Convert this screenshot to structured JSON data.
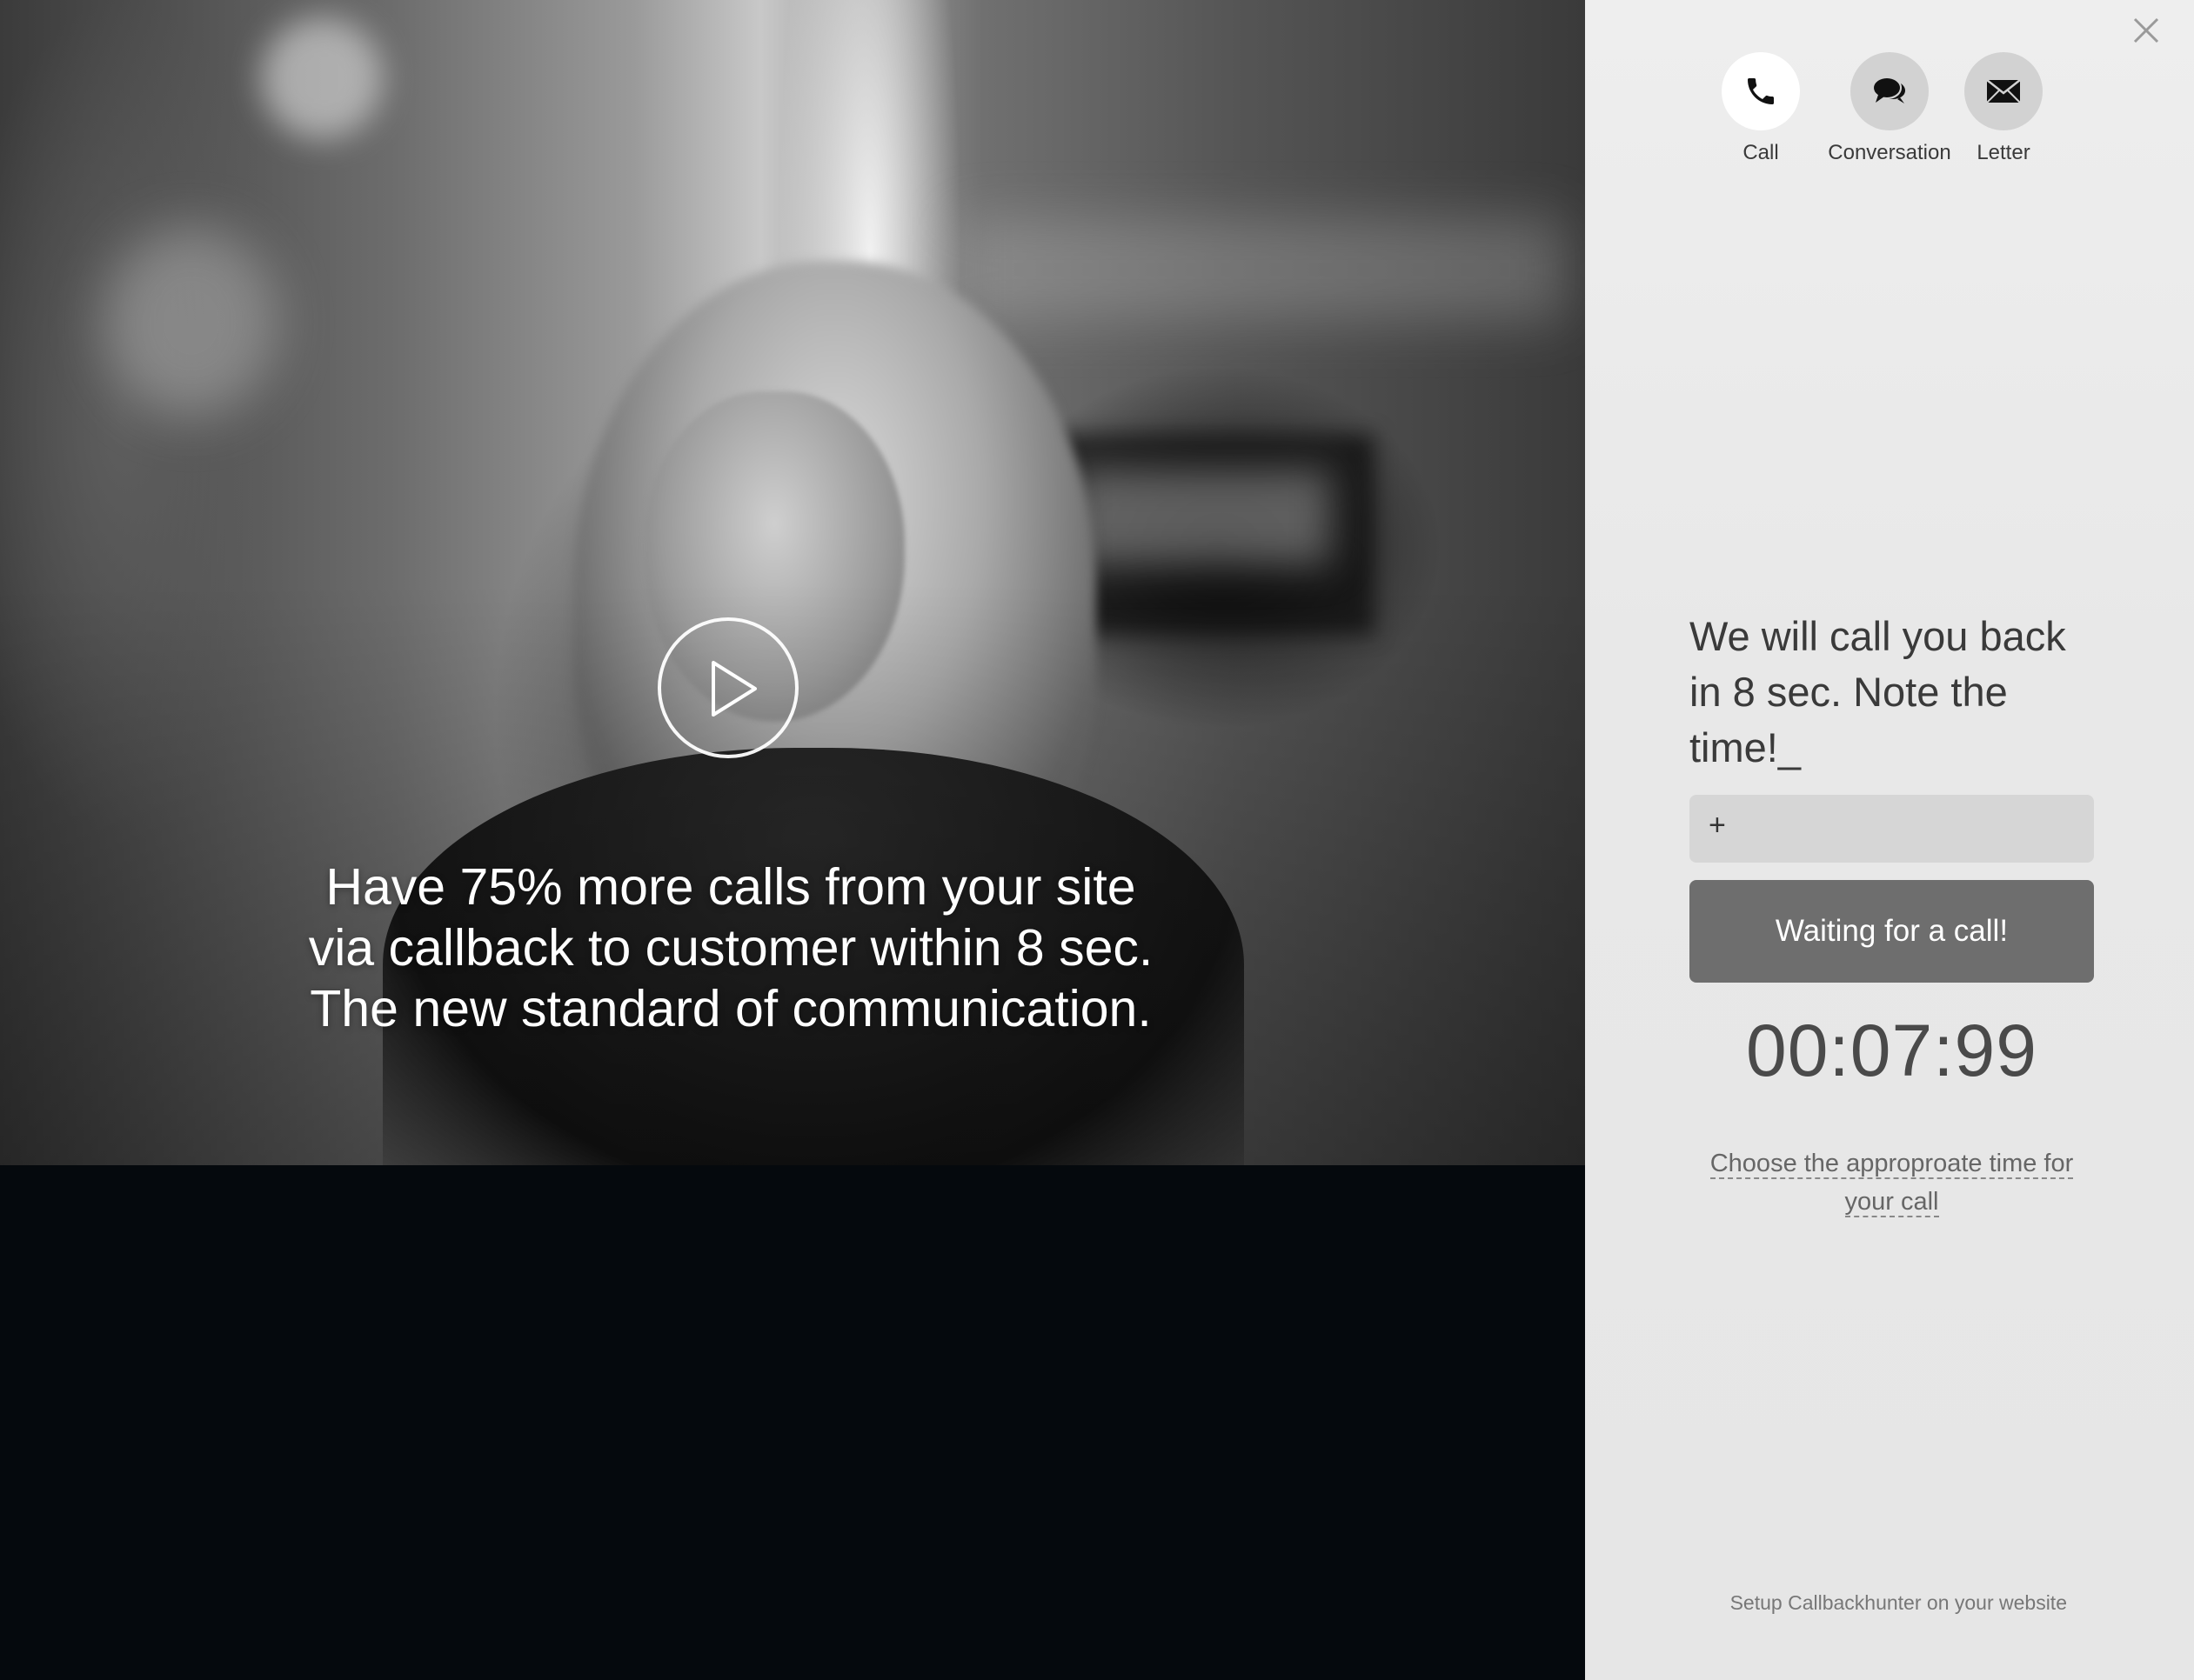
{
  "hero": {
    "headline_lines": [
      "Have 75% more calls from your site",
      "via callback to customer within 8 sec.",
      "The new standard of communication."
    ],
    "play_icon": "play-icon"
  },
  "panel": {
    "close_icon": "close-icon",
    "channels": [
      {
        "label": "Call",
        "icon": "phone-icon",
        "active": true
      },
      {
        "label": "Conversation",
        "icon": "chat-bubbles-icon",
        "active": false
      },
      {
        "label": "Letter",
        "icon": "envelope-icon",
        "active": false
      }
    ],
    "prompt": "We will call you back in 8 sec. Note the time!_",
    "phone_prefix": "+",
    "phone_value": "",
    "cta_label": "Waiting for a call!",
    "timer": "00:07:99",
    "schedule_link": "Choose the approproate time for your call",
    "footer_link": "Setup Callbackhunter on your website"
  },
  "colors": {
    "panel_bg": "#ebebeb",
    "cta_bg": "#6e6e6e",
    "input_bg": "#d6d6d6",
    "active_channel_bg": "#ffffff",
    "inactive_channel_bg": "#d2d2d2"
  }
}
